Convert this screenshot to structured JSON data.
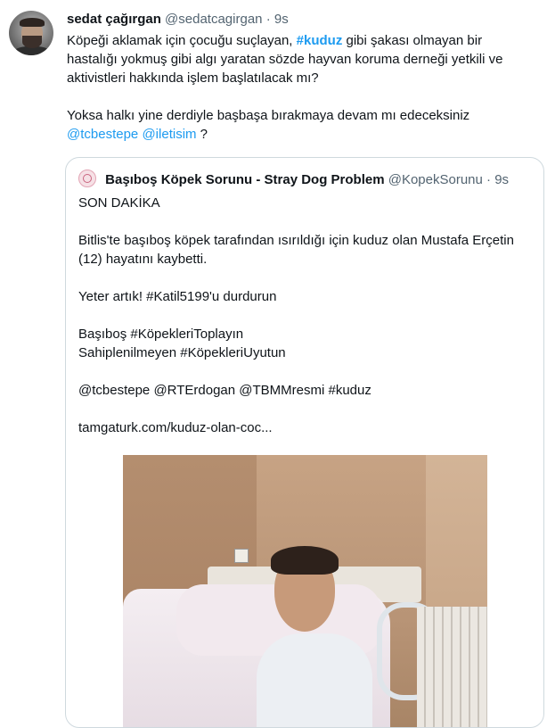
{
  "tweet": {
    "author_name": "sedat çağırgan",
    "author_handle": "@sedatcagirgan",
    "separator": "·",
    "time": "9s",
    "text_p1_before": "Köpeği aklamak için çocuğu suçlayan, ",
    "text_p1_hashtag": "#kuduz",
    "text_p1_after": " gibi şakası olmayan bir hastalığı yokmuş gibi algı yaratan sözde hayvan koruma derneği yetkili ve aktivistleri hakkında işlem başlatılacak mı?",
    "text_p2": "Yoksa halkı yine derdiyle başbaşa bırakmaya devam mı edeceksiniz",
    "mention_1": "@tcbestepe",
    "mention_2": "@iletisim",
    "text_p3_end": " ?"
  },
  "quote": {
    "author_name": "Başıboş Köpek Sorunu - Stray Dog Problem",
    "author_handle": "@KopekSorunu",
    "separator": "·",
    "time": "9s",
    "line1": "SON DAKİKA",
    "line2": "Bitlis'te başıboş köpek tarafından ısırıldığı için kuduz olan Mustafa Erçetin (12) hayatını kaybetti.",
    "line3": "Yeter artık! #Katil5199'u durdurun",
    "line4": "Başıboş #KöpekleriToplayın",
    "line5": "Sahiplenilmeyen #KöpekleriUyutun",
    "line6": "@tcbestepe @RTErdogan @TBMMresmi #kuduz",
    "line7": "tamgaturk.com/kuduz-olan-coc..."
  }
}
